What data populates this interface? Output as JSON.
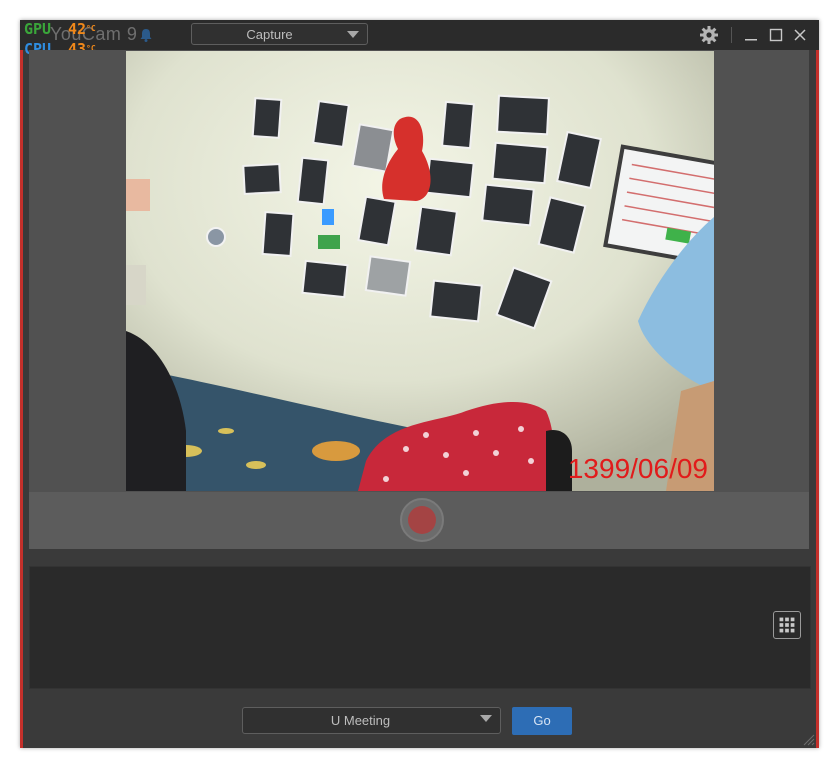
{
  "window": {
    "title": "YouCam 9",
    "mode_select": {
      "value": "Capture"
    },
    "controls": {
      "settings": "gear-icon",
      "minimize": "minimize-icon",
      "maximize": "maximize-icon",
      "close": "close-icon"
    }
  },
  "overlay": {
    "gpu": {
      "label": "GPU",
      "value": "42",
      "unit": "°C"
    },
    "cpu": {
      "label": "CPU",
      "value": "43",
      "unit": "°C"
    }
  },
  "camera": {
    "date_stamp": "1399/06/09"
  },
  "bottom": {
    "meeting_select": "U Meeting",
    "go_label": "Go"
  },
  "colors": {
    "accent": "#2d6db5",
    "frame_red": "#c4302b",
    "date_red": "#e11b1b",
    "record": "#a44444"
  }
}
